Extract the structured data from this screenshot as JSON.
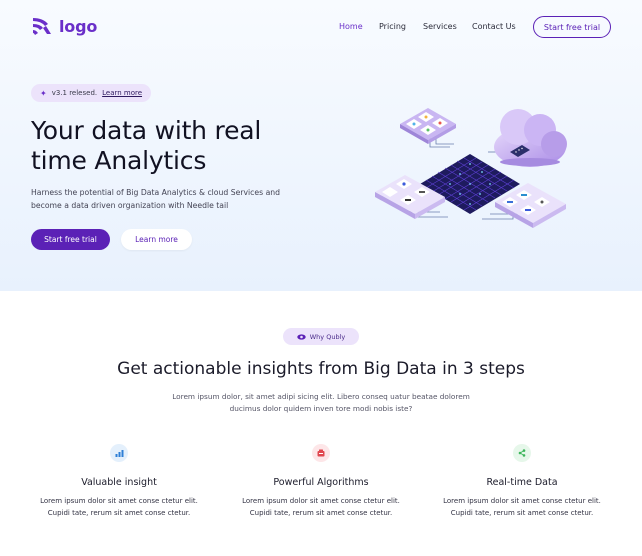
{
  "header": {
    "logo_text": "logo",
    "nav": [
      {
        "label": "Home",
        "active": true
      },
      {
        "label": "Pricing",
        "active": false
      },
      {
        "label": "Services",
        "active": false
      },
      {
        "label": "Contact Us",
        "active": false
      }
    ],
    "cta_label": "Start free trial"
  },
  "hero": {
    "badge_text": "v3.1 relesed.",
    "badge_link": "Learn more",
    "title_line1": "Your data with real",
    "title_line2": "time Analytics",
    "description_line1": "Harness the potential of Big Data Analytics & cloud Services and",
    "description_line2": "become a data driven organization with Needle tail",
    "primary_button": "Start free trial",
    "secondary_button": "Learn more"
  },
  "why": {
    "pill_label": "Why Qubly",
    "title": "Get actionable insights from Big Data in 3 steps",
    "description_line1": "Lorem ipsum dolor, sit amet adipi sicing elit. Libero conseq uatur beatae dolorem",
    "description_line2": "ducimus dolor quidem inven tore modi nobis iste?"
  },
  "features": [
    {
      "title": "Valuable insight",
      "desc_line1": "Lorem ipsum dolor sit amet conse ctetur elit.",
      "desc_line2": "Cupidi tate, rerum sit amet conse ctetur.",
      "icon": "bar-chart-icon"
    },
    {
      "title": "Powerful Algorithms",
      "desc_line1": "Lorem ipsum dolor sit amet conse ctetur elit.",
      "desc_line2": "Cupidi tate, rerum sit amet conse ctetur.",
      "icon": "algorithm-icon"
    },
    {
      "title": "Real-time Data",
      "desc_line1": "Lorem ipsum dolor sit amet conse ctetur elit.",
      "desc_line2": "Cupidi tate, rerum sit amet conse ctetur.",
      "icon": "share-nodes-icon"
    }
  ],
  "colors": {
    "brand": "#5b21b6",
    "logo": "#6a2fc9",
    "badge_bg": "#ece3fb",
    "feature1_bg": "#e4f0fc",
    "feature2_bg": "#fde6e8",
    "feature3_bg": "#e6f7ea"
  }
}
